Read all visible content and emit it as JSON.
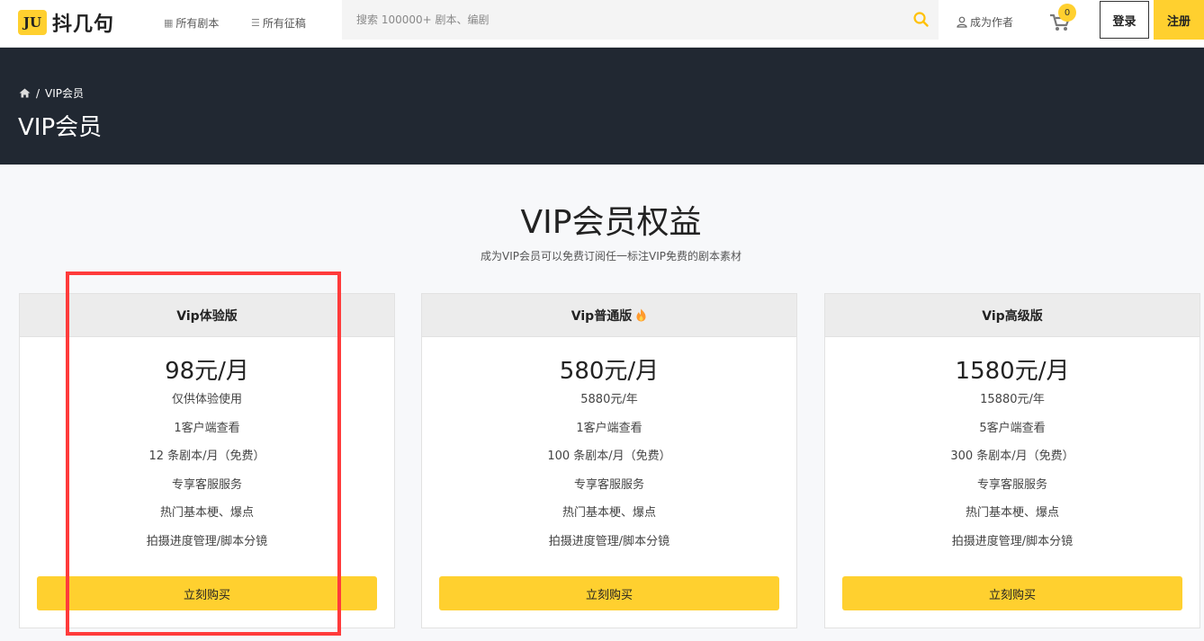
{
  "header": {
    "logo_badge": "JU",
    "logo_text": "抖几句",
    "nav": [
      {
        "icon": "grid-icon",
        "label": "所有剧本"
      },
      {
        "icon": "list-icon",
        "label": "所有征稿"
      }
    ],
    "search": {
      "placeholder": "搜索 100000+ 剧本、编剧",
      "icon": "search-icon"
    },
    "author_link": "成为作者",
    "cart": {
      "icon": "cart-icon",
      "count": "0"
    },
    "login": "登录",
    "register": "注册"
  },
  "hero": {
    "breadcrumb": {
      "home_icon": "home-icon",
      "separator": "/",
      "current": "VIP会员"
    },
    "title": "VIP会员"
  },
  "section": {
    "title": "VIP会员权益",
    "subtitle": "成为VIP会员可以免费订阅任一标注VIP免费的剧本素材"
  },
  "plans": [
    {
      "name": "Vip体验版",
      "hot": false,
      "price": "98元/月",
      "features": [
        "仅供体验使用",
        "1客户端查看",
        "12 条剧本/月（免费）",
        "专享客服服务",
        "热门基本梗、爆点",
        "拍摄进度管理/脚本分镜"
      ],
      "button": "立刻购买"
    },
    {
      "name": "Vip普通版",
      "hot": true,
      "price": "580元/月",
      "features": [
        "5880元/年",
        "1客户端查看",
        "100 条剧本/月（免费）",
        "专享客服服务",
        "热门基本梗、爆点",
        "拍摄进度管理/脚本分镜"
      ],
      "button": "立刻购买"
    },
    {
      "name": "Vip高级版",
      "hot": false,
      "price": "1580元/月",
      "features": [
        "15880元/年",
        "5客户端查看",
        "300 条剧本/月（免费）",
        "专享客服服务",
        "热门基本梗、爆点",
        "拍摄进度管理/脚本分镜"
      ],
      "button": "立刻购买"
    }
  ],
  "colors": {
    "accent": "#ffd02f",
    "hero_bg": "#212832",
    "highlight": "#ff3b3b"
  }
}
